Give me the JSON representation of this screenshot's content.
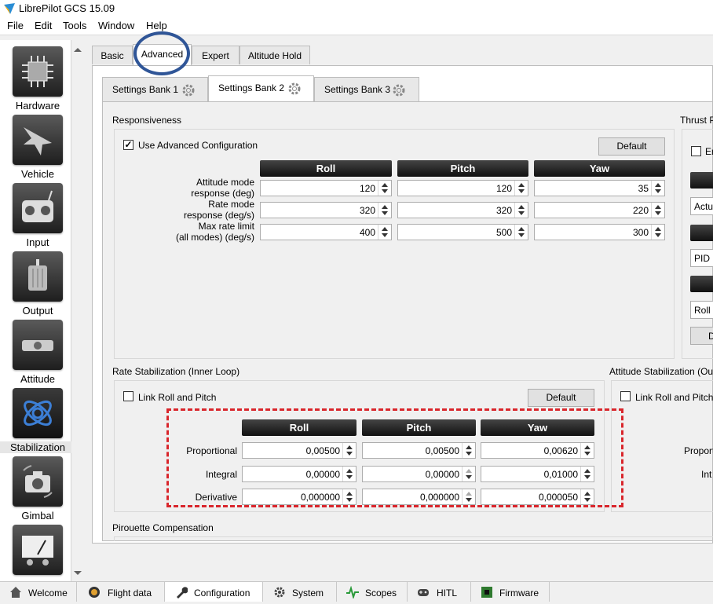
{
  "window": {
    "title": "LibrePilot GCS 15.09"
  },
  "menu": {
    "items": [
      {
        "label": "File"
      },
      {
        "label": "Edit"
      },
      {
        "label": "Tools"
      },
      {
        "label": "Window"
      },
      {
        "label": "Help"
      }
    ]
  },
  "sidebar": {
    "items": [
      {
        "label": "Hardware",
        "icon": "chip-icon"
      },
      {
        "label": "Vehicle",
        "icon": "aircraft-icon"
      },
      {
        "label": "Input",
        "icon": "transmitter-icon"
      },
      {
        "label": "Output",
        "icon": "motor-icon"
      },
      {
        "label": "Attitude",
        "icon": "level-icon"
      },
      {
        "label": "Stabilization",
        "icon": "gyro-icon",
        "active": true
      },
      {
        "label": "Gimbal",
        "icon": "camera-icon"
      },
      {
        "label": "",
        "icon": "gauge-icon"
      }
    ]
  },
  "tabs": [
    {
      "label": "Basic"
    },
    {
      "label": "Advanced",
      "active": true
    },
    {
      "label": "Expert"
    },
    {
      "label": "Altitude Hold"
    }
  ],
  "banks": [
    {
      "label": "Settings Bank 1"
    },
    {
      "label": "Settings Bank 2",
      "active": true
    },
    {
      "label": "Settings Bank 3"
    }
  ],
  "responsiveness": {
    "title": "Responsiveness",
    "use_advanced_label": "Use Advanced Configuration",
    "use_advanced_checked": "✓",
    "default_button": "Default",
    "columns": [
      "Roll",
      "Pitch",
      "Yaw"
    ],
    "rows": [
      {
        "label1": "Attitude mode",
        "label2": "response (deg)",
        "values": [
          "120",
          "120",
          "35"
        ]
      },
      {
        "label1": "Rate mode",
        "label2": "response (deg/s)",
        "values": [
          "320",
          "320",
          "220"
        ]
      },
      {
        "label1": "Max rate limit",
        "label2": "(all modes) (deg/s)",
        "values": [
          "400",
          "500",
          "300"
        ]
      }
    ]
  },
  "thrust_partial": {
    "title": "Thrust P",
    "enable_partial": "En",
    "actu_partial": "Actua",
    "pid_partial": "PID",
    "roll_partial": "Roll F",
    "d_partial": "D"
  },
  "rate_stab": {
    "title": "Rate Stabilization (Inner Loop)",
    "link_label": "Link Roll and Pitch",
    "default_button": "Default",
    "columns": [
      "Roll",
      "Pitch",
      "Yaw"
    ],
    "rows": [
      {
        "label": "Proportional",
        "values": [
          "0,00500",
          "0,00500",
          "0,00620"
        ]
      },
      {
        "label": "Integral",
        "values": [
          "0,00000",
          "0,00000",
          "0,01000"
        ]
      },
      {
        "label": "Derivative",
        "values": [
          "0,000000",
          "0,000000",
          "0,000050"
        ]
      }
    ]
  },
  "attitude_stab": {
    "title": "Attitude Stabilization (Out",
    "link_label": "Link Roll and Pitch",
    "proportional_partial": "Proport",
    "integral_partial": "Int"
  },
  "pirouette": {
    "title": "Pirouette Compensation"
  },
  "bottom_tabs": [
    {
      "label": "Welcome",
      "icon": "home-icon"
    },
    {
      "label": "Flight data",
      "icon": "compass-icon"
    },
    {
      "label": "Configuration",
      "icon": "wrench-icon",
      "active": true
    },
    {
      "label": "System",
      "icon": "gear-icon"
    },
    {
      "label": "Scopes",
      "icon": "pulse-icon"
    },
    {
      "label": "HITL",
      "icon": "gamepad-icon"
    },
    {
      "label": "Firmware",
      "icon": "board-icon"
    }
  ],
  "colors": {
    "highlight_ellipse": "#2f5597",
    "highlight_rect": "#d9262c"
  }
}
